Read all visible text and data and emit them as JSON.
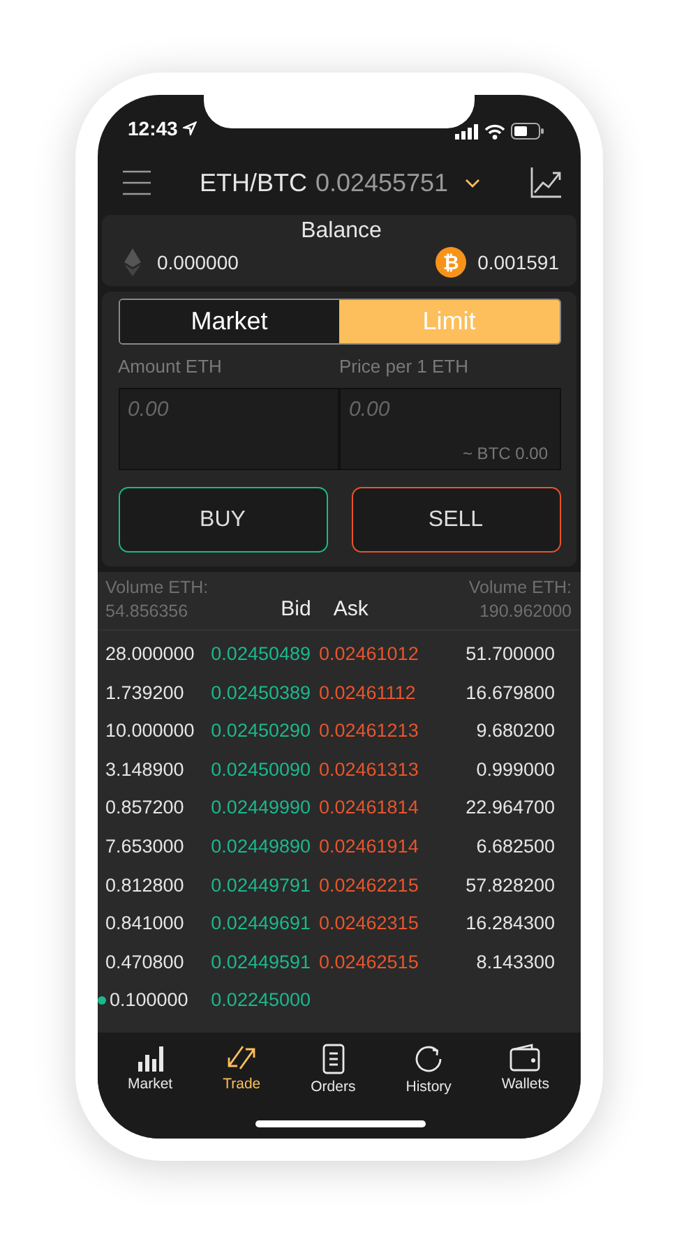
{
  "status_bar": {
    "time": "12:43"
  },
  "header": {
    "pair": "ETH/BTC",
    "price": "0.02455751"
  },
  "balance": {
    "title": "Balance",
    "eth": "0.000000",
    "btc": "0.001591",
    "btc_symbol": "₿"
  },
  "order_form": {
    "tabs": [
      {
        "label": "Market",
        "selected": false
      },
      {
        "label": "Limit",
        "selected": true
      }
    ],
    "amount": {
      "label": "Amount ETH",
      "placeholder": "0.00"
    },
    "price": {
      "label": "Price per 1 ETH",
      "placeholder": "0.00",
      "hint": "~ BTC 0.00"
    },
    "buttons": [
      {
        "label": "BUY",
        "kind": "buy"
      },
      {
        "label": "SELL",
        "kind": "sell"
      }
    ]
  },
  "order_book": {
    "bid_volume_label": "Volume ETH:",
    "bid_volume": "54.856356",
    "bid_heading": "Bid",
    "ask_heading": "Ask",
    "ask_volume_label": "Volume ETH:",
    "ask_volume": "190.962000",
    "rows": [
      {
        "bid_amount": "28.000000",
        "bid_price": "0.02450489",
        "ask_price": "0.02461012",
        "ask_amount": "51.700000",
        "own": false
      },
      {
        "bid_amount": "1.739200",
        "bid_price": "0.02450389",
        "ask_price": "0.02461112",
        "ask_amount": "16.679800",
        "own": false
      },
      {
        "bid_amount": "10.000000",
        "bid_price": "0.02450290",
        "ask_price": "0.02461213",
        "ask_amount": "9.680200",
        "own": false
      },
      {
        "bid_amount": "3.148900",
        "bid_price": "0.02450090",
        "ask_price": "0.02461313",
        "ask_amount": "0.999000",
        "own": false
      },
      {
        "bid_amount": "0.857200",
        "bid_price": "0.02449990",
        "ask_price": "0.02461814",
        "ask_amount": "22.964700",
        "own": false
      },
      {
        "bid_amount": "7.653000",
        "bid_price": "0.02449890",
        "ask_price": "0.02461914",
        "ask_amount": "6.682500",
        "own": false
      },
      {
        "bid_amount": "0.812800",
        "bid_price": "0.02449791",
        "ask_price": "0.02462215",
        "ask_amount": "57.828200",
        "own": false
      },
      {
        "bid_amount": "0.841000",
        "bid_price": "0.02449691",
        "ask_price": "0.02462315",
        "ask_amount": "16.284300",
        "own": false
      },
      {
        "bid_amount": "0.470800",
        "bid_price": "0.02449591",
        "ask_price": "0.02462515",
        "ask_amount": "8.143300",
        "own": false
      },
      {
        "bid_amount": "0.100000",
        "bid_price": "0.02245000",
        "own": true
      }
    ]
  },
  "tab_bar": [
    {
      "label": "Market",
      "kind": "bars",
      "selected": false
    },
    {
      "label": "Trade",
      "kind": "arrows",
      "selected": true
    },
    {
      "label": "Orders",
      "kind": "document",
      "selected": false
    },
    {
      "label": "History",
      "kind": "refresh",
      "selected": false
    },
    {
      "label": "Wallets",
      "kind": "wallet",
      "selected": false
    }
  ]
}
